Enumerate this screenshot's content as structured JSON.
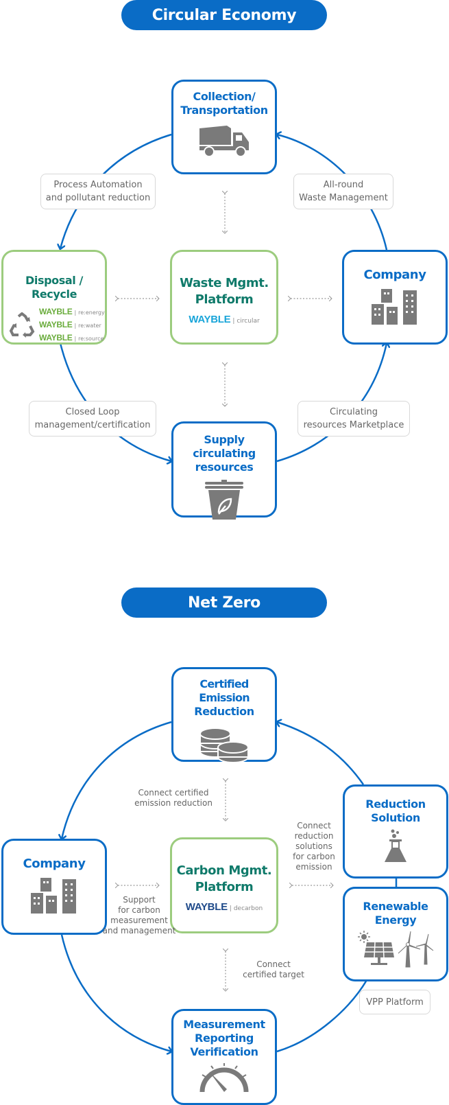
{
  "colors": {
    "primary": "#0a6cc6",
    "green_border": "#9ccc7e",
    "green_text": "#0f7a6a",
    "wayble_green": "#6aac3c",
    "wayble_cyan": "#1aa5d9",
    "wayble_navy": "#1f4a8a",
    "icon_gray": "#7a7a7a"
  },
  "circular": {
    "header": "Circular Economy",
    "collection": {
      "title_1": "Collection/",
      "title_2": "Transportation",
      "icon": "dump-truck-icon"
    },
    "disposal": {
      "title": "Disposal / Recycle",
      "icon": "recycle-icon",
      "brands": [
        {
          "brand": "WAYBLE",
          "sub": "re:energy"
        },
        {
          "brand": "WAYBLE",
          "sub": "re:water"
        },
        {
          "brand": "WAYBLE",
          "sub": "re:source"
        }
      ]
    },
    "platform": {
      "title_1": "Waste Mgmt.",
      "title_2": "Platform",
      "brand": "WAYBLE",
      "sub": "circular"
    },
    "company": {
      "title": "Company",
      "icon": "buildings-icon"
    },
    "supply": {
      "title_1": "Supply circulating",
      "title_2": "resources",
      "icon": "eco-bin-icon"
    },
    "notes": {
      "top_left": [
        "Process Automation",
        "and pollutant reduction"
      ],
      "top_right": [
        "All-round",
        "Waste Management"
      ],
      "bottom_left": [
        "Closed Loop",
        "management/certification"
      ],
      "bottom_right": [
        "Circulating",
        "resources Marketplace"
      ]
    }
  },
  "netzero": {
    "header": "Net Zero",
    "cer": {
      "title_1": "Certified Emission",
      "title_2": "Reduction",
      "icon": "coins-icon"
    },
    "company": {
      "title": "Company",
      "icon": "buildings-icon"
    },
    "platform": {
      "title_1": "Carbon Mgmt.",
      "title_2": "Platform",
      "brand": "WAYBLE",
      "sub": "decarbon"
    },
    "reduction": {
      "title_1": "Reduction",
      "title_2": "Solution",
      "icon": "flask-icon"
    },
    "renewable": {
      "title_1": "Renewable",
      "title_2": "Energy",
      "icon": "solar-wind-icon"
    },
    "mrv": {
      "title_1": "Measurement",
      "title_2": "Reporting",
      "title_3": "Verification",
      "icon": "gauge-icon"
    },
    "vpp": "VPP Platform",
    "labels": {
      "top": [
        "Connect certified",
        "emission reduction"
      ],
      "right": [
        "Connect",
        "reduction",
        "solutions",
        "for carbon",
        "emission"
      ],
      "left": [
        "Support",
        "for carbon",
        "measurement",
        "and management"
      ],
      "bottom": [
        "Connect",
        "certified target"
      ]
    }
  }
}
